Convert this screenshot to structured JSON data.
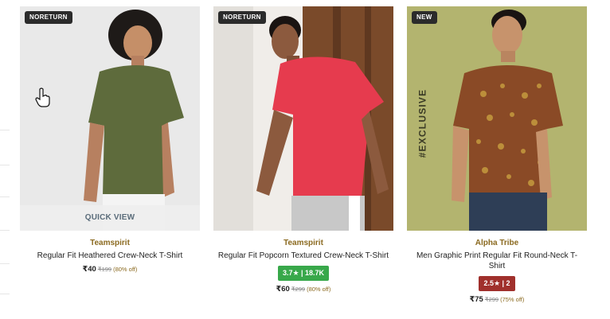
{
  "products": [
    {
      "tag": "NORETURN",
      "quick_view": "QUICK VIEW",
      "brand": "Teamspirit",
      "name": "Regular Fit Heathered Crew-Neck T-Shirt",
      "rating": "",
      "price": "₹40",
      "mrp": "₹199",
      "discount": "(80% off)",
      "bg_color": "#e9e9e9",
      "shirt_color": "#5e6b3c"
    },
    {
      "tag": "NORETURN",
      "brand": "Teamspirit",
      "name": "Regular Fit Popcorn Textured Crew-Neck T-Shirt",
      "rating": "3.7★ | 18.7K",
      "price": "₹60",
      "mrp": "₹299",
      "discount": "(80% off)",
      "bg_color": "#7a4a2a",
      "shirt_color": "#e63b4e"
    },
    {
      "tag": "NEW",
      "side_text": "#EXCLUSIVE",
      "brand": "Alpha Tribe",
      "name": "Men Graphic Print Regular Fit Round-Neck T-Shirt",
      "rating": "2.5★ | 2",
      "price": "₹75",
      "mrp": "₹299",
      "discount": "(75% off)",
      "bg_color": "#b3b46f",
      "shirt_color": "#8a4a26"
    }
  ],
  "icons": {
    "cursor": "hand-pointer-icon"
  }
}
